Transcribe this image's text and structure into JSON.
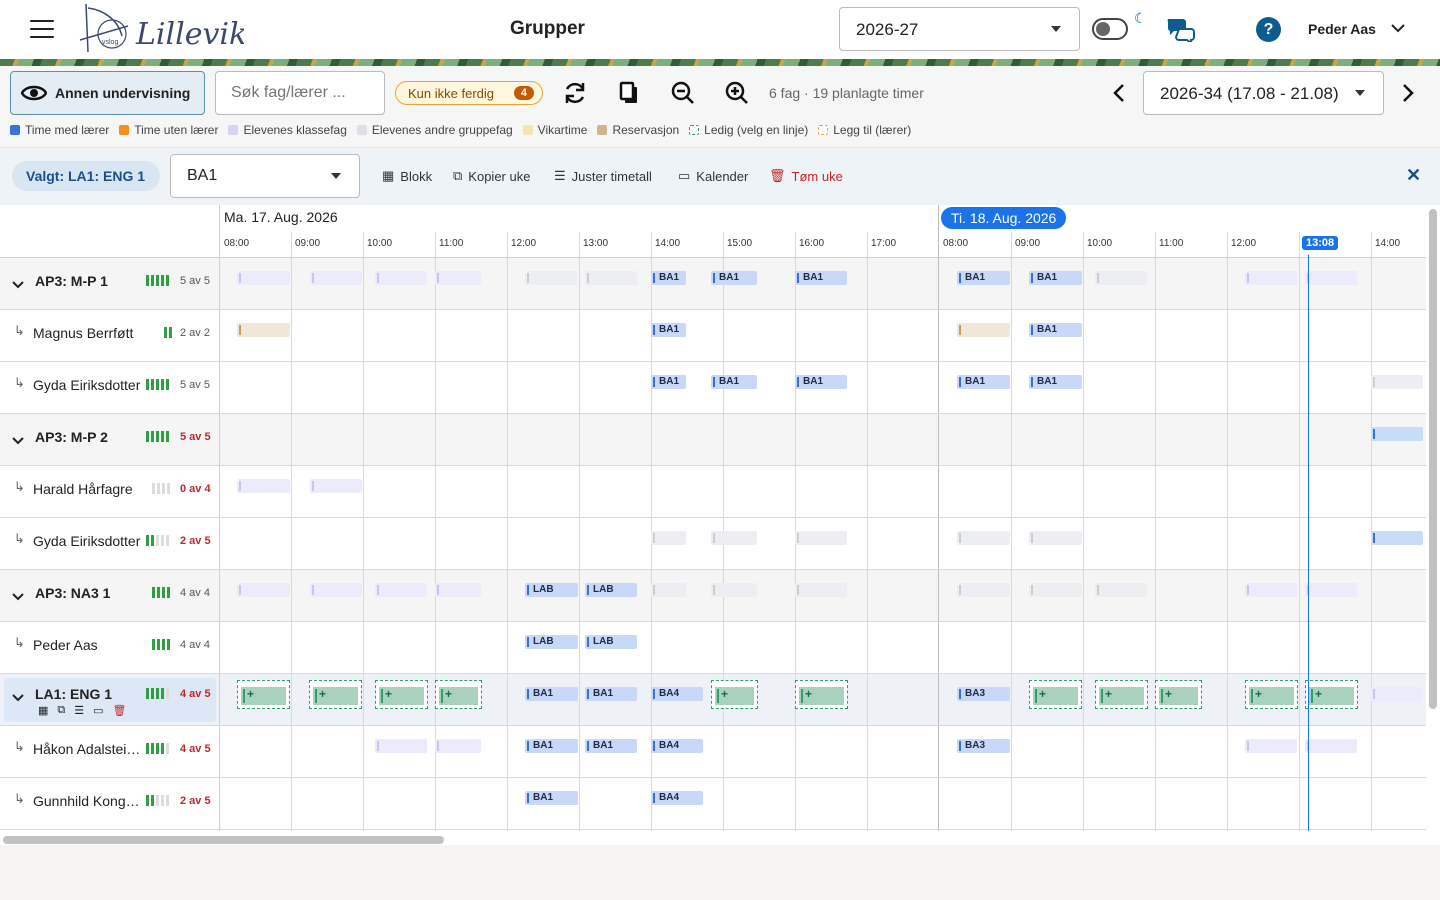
{
  "header": {
    "title": "Grupper",
    "school_year": "2026-27",
    "user_name": "Peder Aas",
    "help_label": "?",
    "logo_text": "Lillevik"
  },
  "toolbar": {
    "annen_label": "Annen undervisning",
    "search_placeholder": "Søk fag/lærer ...",
    "filter_label": "Kun ikke ferdig",
    "filter_count": "4",
    "stats": "6 fag · 19 planlagte timer",
    "week": "2026-34 (17.08 - 21.08)"
  },
  "legend": [
    {
      "label": "Time med lærer",
      "color": "#3b74d9"
    },
    {
      "label": "Time uten lærer",
      "color": "#f0931e"
    },
    {
      "label": "Elevenes klassefag",
      "color": "#d8d3f2"
    },
    {
      "label": "Elevenes andre gruppefag",
      "color": "#dcdfe4"
    },
    {
      "label": "Vikartime",
      "color": "#f6e4b2"
    },
    {
      "label": "Reservasjon",
      "color": "#d2b48c"
    },
    {
      "label": "Ledig (velg en linje)",
      "color": "#2e9e6a"
    },
    {
      "label": "Legg til (lærer)",
      "color": "#e8a43a"
    }
  ],
  "selection": {
    "selected_label": "Valgt: LA1: ENG 1",
    "class_value": "BA1",
    "actions": [
      "Blokk",
      "Kopier uke",
      "Juster timetall",
      "Kalender",
      "Tøm uke"
    ]
  },
  "calendar": {
    "day1": "Ma. 17. Aug. 2026",
    "day2": "Ti. 18. Aug. 2026",
    "hours1": [
      "08:00",
      "09:00",
      "10:00",
      "11:00",
      "12:00",
      "13:00",
      "14:00",
      "15:00",
      "16:00",
      "17:00"
    ],
    "hours2": [
      "08:00",
      "09:00",
      "10:00",
      "11:00",
      "12:00",
      "14:00"
    ],
    "now": "13:08"
  },
  "rows": [
    {
      "name": "AP3: M-P 1",
      "group": true,
      "done": 5,
      "total": 5,
      "count": "5 av 5",
      "red": false
    },
    {
      "name": "Magnus Berrføtt",
      "group": false,
      "done": 2,
      "total": 2,
      "count": "2 av 2",
      "red": false
    },
    {
      "name": "Gyda Eiriksdotter",
      "group": false,
      "done": 5,
      "total": 5,
      "count": "5 av 5",
      "red": false
    },
    {
      "name": "AP3: M-P 2",
      "group": true,
      "done": 5,
      "total": 5,
      "count": "5 av 5",
      "red": true
    },
    {
      "name": "Harald Hårfagre",
      "group": false,
      "done": 0,
      "total": 4,
      "count": "0 av 4",
      "red": true
    },
    {
      "name": "Gyda Eiriksdotter",
      "group": false,
      "done": 2,
      "total": 5,
      "count": "2 av 5",
      "red": true
    },
    {
      "name": "AP3: NA3 1",
      "group": true,
      "done": 4,
      "total": 4,
      "count": "4 av 4",
      "red": false
    },
    {
      "name": "Peder Aas",
      "group": false,
      "done": 4,
      "total": 4,
      "count": "4 av 4",
      "red": false
    },
    {
      "name": "LA1: ENG 1",
      "group": true,
      "done": 4,
      "total": 5,
      "count": "4 av 5",
      "red": true
    },
    {
      "name": "Håkon Adalstei…",
      "group": false,
      "done": 4,
      "total": 5,
      "count": "4 av 5",
      "red": true
    },
    {
      "name": "Gunnhild Kong…",
      "group": false,
      "done": 2,
      "total": 5,
      "count": "2 av 5",
      "red": true
    }
  ],
  "event_labels": {
    "ba1": "BA1",
    "ba3": "BA3",
    "ba4": "BA4",
    "lab": "LAB"
  }
}
